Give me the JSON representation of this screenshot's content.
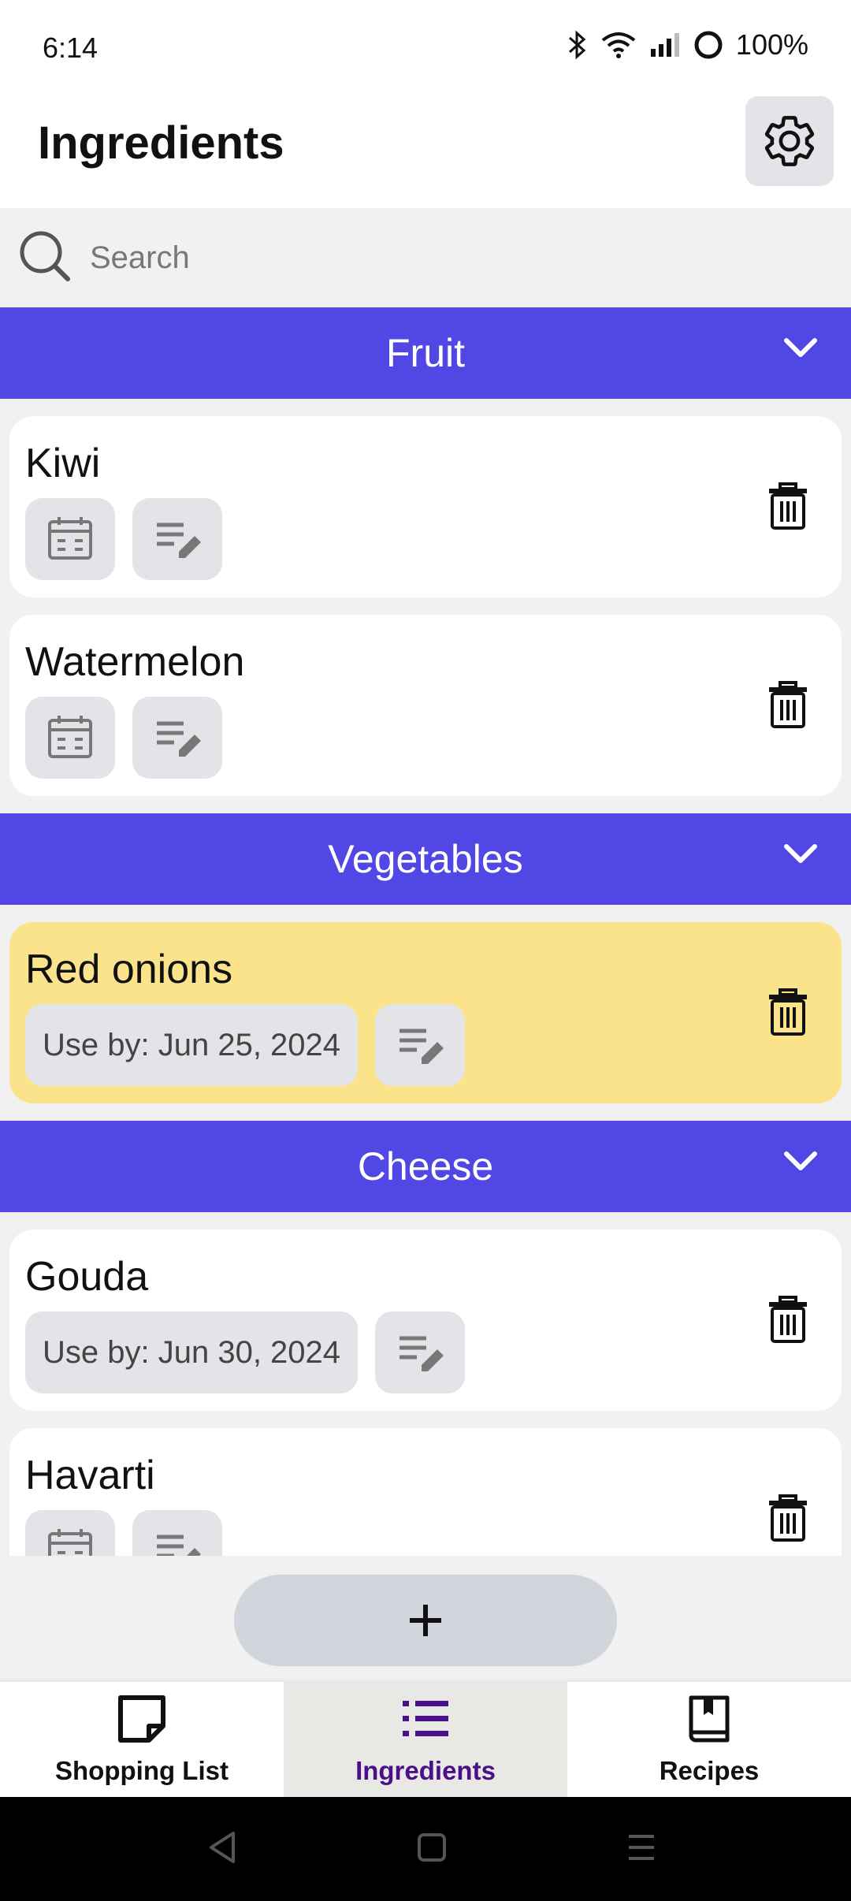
{
  "status_bar": {
    "time": "6:14",
    "battery": "100%"
  },
  "header": {
    "title": "Ingredients"
  },
  "search": {
    "placeholder": "Search",
    "value": ""
  },
  "categories": [
    {
      "name": "Fruit"
    },
    {
      "name": "Vegetables"
    },
    {
      "name": "Cheese"
    }
  ],
  "items": [
    {
      "name": "Kiwi",
      "category": "Fruit",
      "use_by": ""
    },
    {
      "name": "Watermelon",
      "category": "Fruit",
      "use_by": ""
    },
    {
      "name": "Red onions",
      "category": "Vegetables",
      "use_by": "Use by: Jun 25, 2024"
    },
    {
      "name": "Gouda",
      "category": "Cheese",
      "use_by": "Use by: Jun 30, 2024"
    },
    {
      "name": "Havarti",
      "category": "Cheese",
      "use_by": ""
    }
  ],
  "bottom_nav": [
    {
      "label": "Shopping List",
      "icon": "note-icon"
    },
    {
      "label": "Ingredients",
      "icon": "list-icon",
      "active": true
    },
    {
      "label": "Recipes",
      "icon": "book-icon"
    }
  ],
  "colors": {
    "category_header": "#5047e5",
    "expiring_item": "#fbe38c",
    "active_nav_label": "#4b0f8a"
  }
}
